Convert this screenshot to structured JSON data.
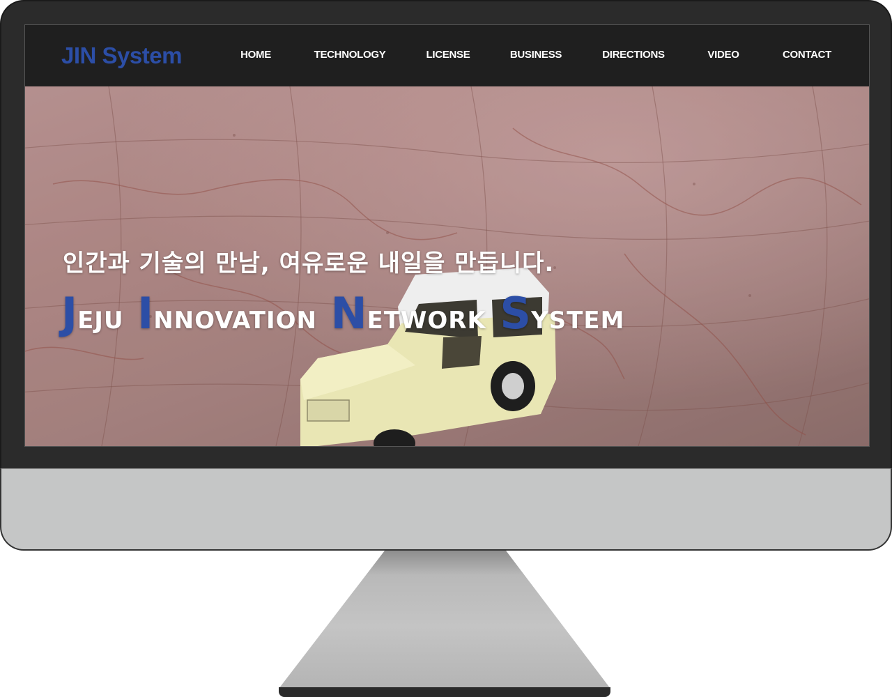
{
  "site": {
    "logo_text": "JIN System",
    "nav": [
      {
        "label": "HOME"
      },
      {
        "label": "TECHNOLOGY"
      },
      {
        "label": "LICENSE"
      },
      {
        "label": "BUSINESS"
      },
      {
        "label": "DIRECTIONS"
      },
      {
        "label": "VIDEO"
      },
      {
        "label": "CONTACT"
      }
    ]
  },
  "hero": {
    "tagline": "인간과 기술의 만남, 여유로운 내일을 만듭니다.",
    "title_words": [
      {
        "initial": "J",
        "rest": "EJU"
      },
      {
        "initial": "I",
        "rest": "NNOVATION"
      },
      {
        "initial": "N",
        "rest": "ETWORK"
      },
      {
        "initial": "S",
        "rest": "YSTEM"
      }
    ],
    "image": "vintage toy car on old map"
  },
  "colors": {
    "brand_blue": "#2c4ea6",
    "header_bg": "#1f1f1f",
    "monitor_bezel": "#2b2b2b",
    "monitor_chin": "#c5c6c6"
  }
}
